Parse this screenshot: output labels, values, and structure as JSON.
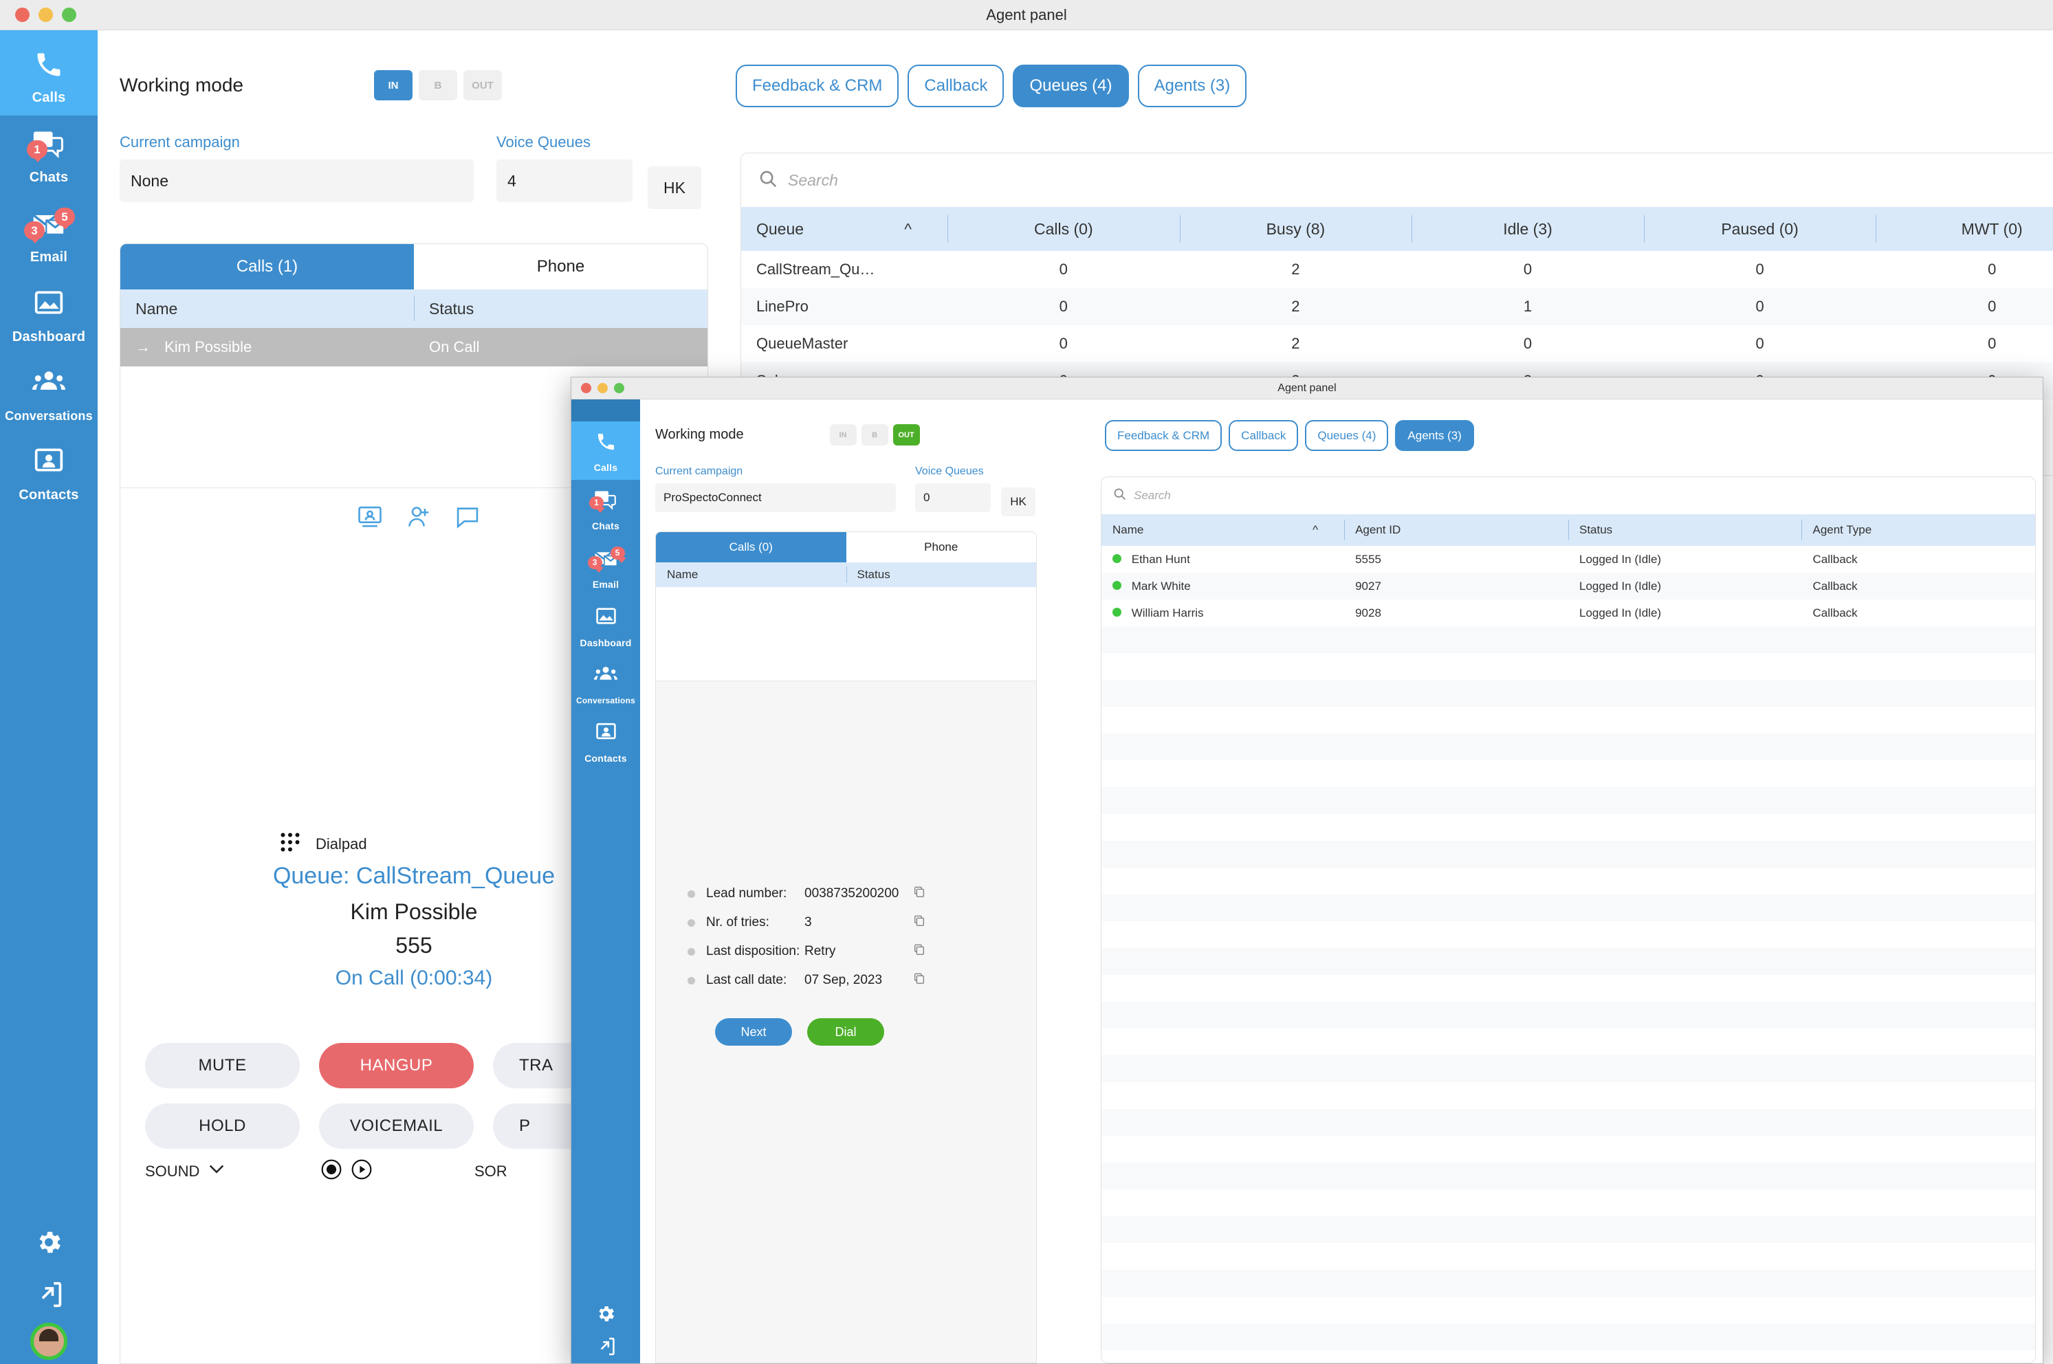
{
  "background_window": {
    "title": "Agent panel",
    "sidebar": {
      "items": [
        {
          "label": "Calls",
          "icon": "phone-icon",
          "active": true,
          "badges": []
        },
        {
          "label": "Chats",
          "icon": "chat-icon",
          "active": false,
          "badges": [
            "1"
          ]
        },
        {
          "label": "Email",
          "icon": "email-icon",
          "active": false,
          "badges": [
            "3",
            "5"
          ]
        },
        {
          "label": "Dashboard",
          "icon": "dashboard-icon",
          "active": false,
          "badges": []
        },
        {
          "label": "Conversations",
          "icon": "conversations-icon",
          "active": false,
          "badges": []
        },
        {
          "label": "Contacts",
          "icon": "contacts-icon",
          "active": false,
          "badges": []
        }
      ],
      "bottom": [
        {
          "icon": "gear-icon"
        },
        {
          "icon": "logout-icon"
        },
        {
          "icon": "avatar"
        }
      ]
    },
    "working_mode": {
      "title": "Working mode",
      "modes": [
        {
          "label": "IN",
          "state": "selected-blue"
        },
        {
          "label": "B",
          "state": "off"
        },
        {
          "label": "OUT",
          "state": "off"
        }
      ]
    },
    "tabs": [
      {
        "label": "Feedback & CRM",
        "active": false
      },
      {
        "label": "Callback",
        "active": false
      },
      {
        "label": "Queues (4)",
        "active": true
      },
      {
        "label": "Agents (3)",
        "active": false
      }
    ],
    "fields": {
      "campaign_label": "Current campaign",
      "campaign_value": "None",
      "queues_label": "Voice Queues",
      "queues_value": "4",
      "locale_value": "HK"
    },
    "search": {
      "placeholder": "Search",
      "value": ""
    },
    "queues_table": {
      "columns": [
        "Queue",
        "Calls (0)",
        "Busy (8)",
        "Idle (3)",
        "Paused (0)",
        "MWT (0)"
      ],
      "sort_column": "Queue",
      "sort_dir": "asc",
      "rows": [
        [
          "CallStream_Qu…",
          "0",
          "2",
          "0",
          "0",
          "0"
        ],
        [
          "LinePro",
          "0",
          "2",
          "1",
          "0",
          "0"
        ],
        [
          "QueueMaster",
          "0",
          "2",
          "0",
          "0",
          "0"
        ],
        [
          "Sales",
          "0",
          "2",
          "2",
          "0",
          "0"
        ]
      ]
    },
    "call_list": {
      "tabs": [
        {
          "label": "Calls (1)",
          "active": true
        },
        {
          "label": "Phone",
          "active": false
        }
      ],
      "columns": [
        "Name",
        "Status"
      ],
      "rows": [
        {
          "direction_icon": "arrow-right-icon",
          "name": "Kim Possible",
          "status": "On Call",
          "selected": true
        }
      ]
    },
    "call_actions_icons": [
      "screen-share-icon",
      "add-user-icon",
      "comment-icon"
    ],
    "dialpad": {
      "label": "Dialpad",
      "icon": "dialpad-icon"
    },
    "active_call": {
      "queue": "Queue: CallStream_Queue",
      "caller": "Kim Possible",
      "number": "555",
      "status": "On Call (0:00:34)"
    },
    "call_buttons": [
      {
        "label": "MUTE",
        "style": "normal"
      },
      {
        "label": "HANGUP",
        "style": "danger"
      },
      {
        "label": "TRA",
        "style": "normal"
      },
      {
        "label": "HOLD",
        "style": "normal"
      },
      {
        "label": "VOICEMAIL",
        "style": "normal"
      },
      {
        "label": "P",
        "style": "normal"
      }
    ],
    "footer_controls": {
      "sound_label": "SOUND",
      "sound_chevron": "chevron-down-icon",
      "record_icon": "record-icon",
      "play_icon": "play-icon",
      "sort_label": "SOR"
    }
  },
  "foreground_window": {
    "title": "Agent panel",
    "sidebar": {
      "items": [
        {
          "label": "Calls",
          "icon": "phone-icon",
          "active": true,
          "badges": []
        },
        {
          "label": "Chats",
          "icon": "chat-icon",
          "active": false,
          "badges": [
            "1"
          ]
        },
        {
          "label": "Email",
          "icon": "email-icon",
          "active": false,
          "badges": [
            "3",
            "5"
          ]
        },
        {
          "label": "Dashboard",
          "icon": "dashboard-icon",
          "active": false,
          "badges": []
        },
        {
          "label": "Conversations",
          "icon": "conversations-icon",
          "active": false,
          "badges": []
        },
        {
          "label": "Contacts",
          "icon": "contacts-icon",
          "active": false,
          "badges": []
        }
      ],
      "bottom": [
        {
          "icon": "gear-icon"
        },
        {
          "icon": "logout-icon"
        }
      ]
    },
    "working_mode": {
      "title": "Working mode",
      "modes": [
        {
          "label": "IN",
          "state": "off"
        },
        {
          "label": "B",
          "state": "off"
        },
        {
          "label": "OUT",
          "state": "selected-green"
        }
      ]
    },
    "tabs": [
      {
        "label": "Feedback & CRM",
        "active": false
      },
      {
        "label": "Callback",
        "active": false
      },
      {
        "label": "Queues (4)",
        "active": false
      },
      {
        "label": "Agents (3)",
        "active": true
      }
    ],
    "fields": {
      "campaign_label": "Current campaign",
      "campaign_value": "ProSpectoConnect",
      "queues_label": "Voice Queues",
      "queues_value": "0",
      "locale_value": "HK"
    },
    "search": {
      "placeholder": "Search",
      "value": ""
    },
    "agents_table": {
      "columns": [
        "Name",
        "Agent ID",
        "Status",
        "Agent Type"
      ],
      "sort_column": "Name",
      "sort_dir": "asc",
      "rows": [
        {
          "presence": "online",
          "name": "Ethan Hunt",
          "agent_id": "5555",
          "status": "Logged In (Idle)",
          "agent_type": "Callback"
        },
        {
          "presence": "online",
          "name": "Mark White",
          "agent_id": "9027",
          "status": "Logged In (Idle)",
          "agent_type": "Callback"
        },
        {
          "presence": "online",
          "name": "William Harris",
          "agent_id": "9028",
          "status": "Logged In (Idle)",
          "agent_type": "Callback"
        }
      ]
    },
    "call_list": {
      "tabs": [
        {
          "label": "Calls (0)",
          "active": true
        },
        {
          "label": "Phone",
          "active": false
        }
      ],
      "columns": [
        "Name",
        "Status"
      ],
      "rows": []
    },
    "lead_info": {
      "items": [
        {
          "label": "Lead number:",
          "value": "0038735200200",
          "copy_icon": "copy-icon"
        },
        {
          "label": "Nr. of tries:",
          "value": "3",
          "copy_icon": "copy-icon"
        },
        {
          "label": "Last disposition:",
          "value": "Retry",
          "copy_icon": "copy-icon"
        },
        {
          "label": "Last call date:",
          "value": "07 Sep, 2023",
          "copy_icon": "copy-icon"
        }
      ],
      "buttons": [
        {
          "label": "Next",
          "style": "blue"
        },
        {
          "label": "Dial",
          "style": "green"
        }
      ]
    }
  },
  "colors": {
    "sidebar_bg": "#3a8dcc",
    "sidebar_active": "#4db3f5",
    "accent_blue": "#3d8dce",
    "danger_red": "#e8696c",
    "success_green": "#4caf28",
    "badge_red": "#ef6b6b",
    "table_header": "#d9e9f9"
  }
}
